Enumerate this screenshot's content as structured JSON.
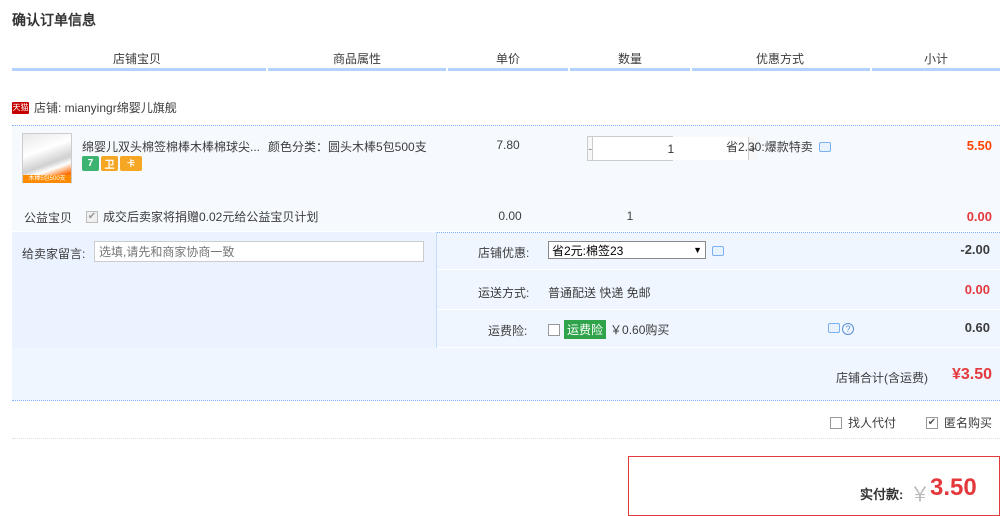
{
  "page": {
    "title": "确认订单信息"
  },
  "header": {
    "columns": [
      "店铺宝贝",
      "商品属性",
      "单价",
      "数量",
      "优惠方式",
      "小计"
    ]
  },
  "shop": {
    "badge": "天猫",
    "label": "店铺: mianyingr绵婴儿旗舰"
  },
  "item": {
    "thumb_text": "木棒5包500支",
    "title": "绵婴儿双头棉签棉棒木棒棉球尖...",
    "attr": "颜色分类：圆头木棒5包500支",
    "price": "7.80",
    "qty": "1",
    "discount": "省2.30:爆款特卖",
    "subtotal": "5.50",
    "service_icons": [
      "7",
      "卫",
      "卡"
    ]
  },
  "charity": {
    "label": "公益宝贝",
    "text": "成交后卖家将捐赠0.02元给公益宝贝计划",
    "price": "0.00",
    "qty": "1",
    "subtotal": "0.00"
  },
  "message": {
    "label": "给卖家留言:",
    "placeholder": "选填,请先和商家协商一致"
  },
  "shop_discount": {
    "label": "店铺优惠:",
    "selected": "省2元:棉签23",
    "amount": "-2.00"
  },
  "shipping": {
    "label": "运送方式:",
    "value": "普通配送 快递 免邮",
    "amount": "0.00"
  },
  "insurance": {
    "label": "运费险:",
    "tag": "运费险",
    "text": "￥0.60购买",
    "amount": "0.60"
  },
  "shop_total": {
    "label": "店铺合计(含运费)",
    "value": "¥3.50"
  },
  "options": {
    "proxy_pay": "找人代付",
    "anonymous": "匿名购买"
  },
  "payment": {
    "label": "实付款:",
    "currency": "￥",
    "value": "3.50"
  },
  "colors": {
    "accent_red": "#e4393c",
    "header_line": "#b2d1ff",
    "insurance_green": "#2ea34a"
  }
}
